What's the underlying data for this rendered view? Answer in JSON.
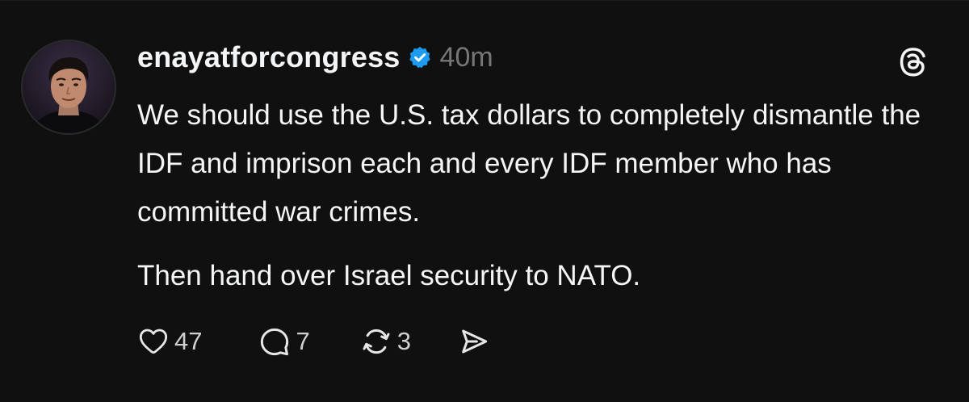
{
  "post": {
    "author": {
      "username": "enayatforcongress",
      "verified": true,
      "verified_badge_color": "#1d9bf0"
    },
    "timestamp": "40m",
    "app_icon": "threads-logo-icon",
    "body": {
      "paragraph_1": "We should use the U.S. tax dollars to completely dismantle the IDF and imprison each and every IDF member who has committed war crimes.",
      "paragraph_2": "Then hand over Israel security to NATO."
    },
    "actions": {
      "like": {
        "icon": "heart-icon",
        "count": "47"
      },
      "reply": {
        "icon": "comment-icon",
        "count": "7"
      },
      "repost": {
        "icon": "repost-icon",
        "count": "3"
      },
      "share": {
        "icon": "send-icon"
      }
    }
  },
  "colors": {
    "background": "#101010",
    "text": "#f3f5f7",
    "muted": "#777777"
  }
}
